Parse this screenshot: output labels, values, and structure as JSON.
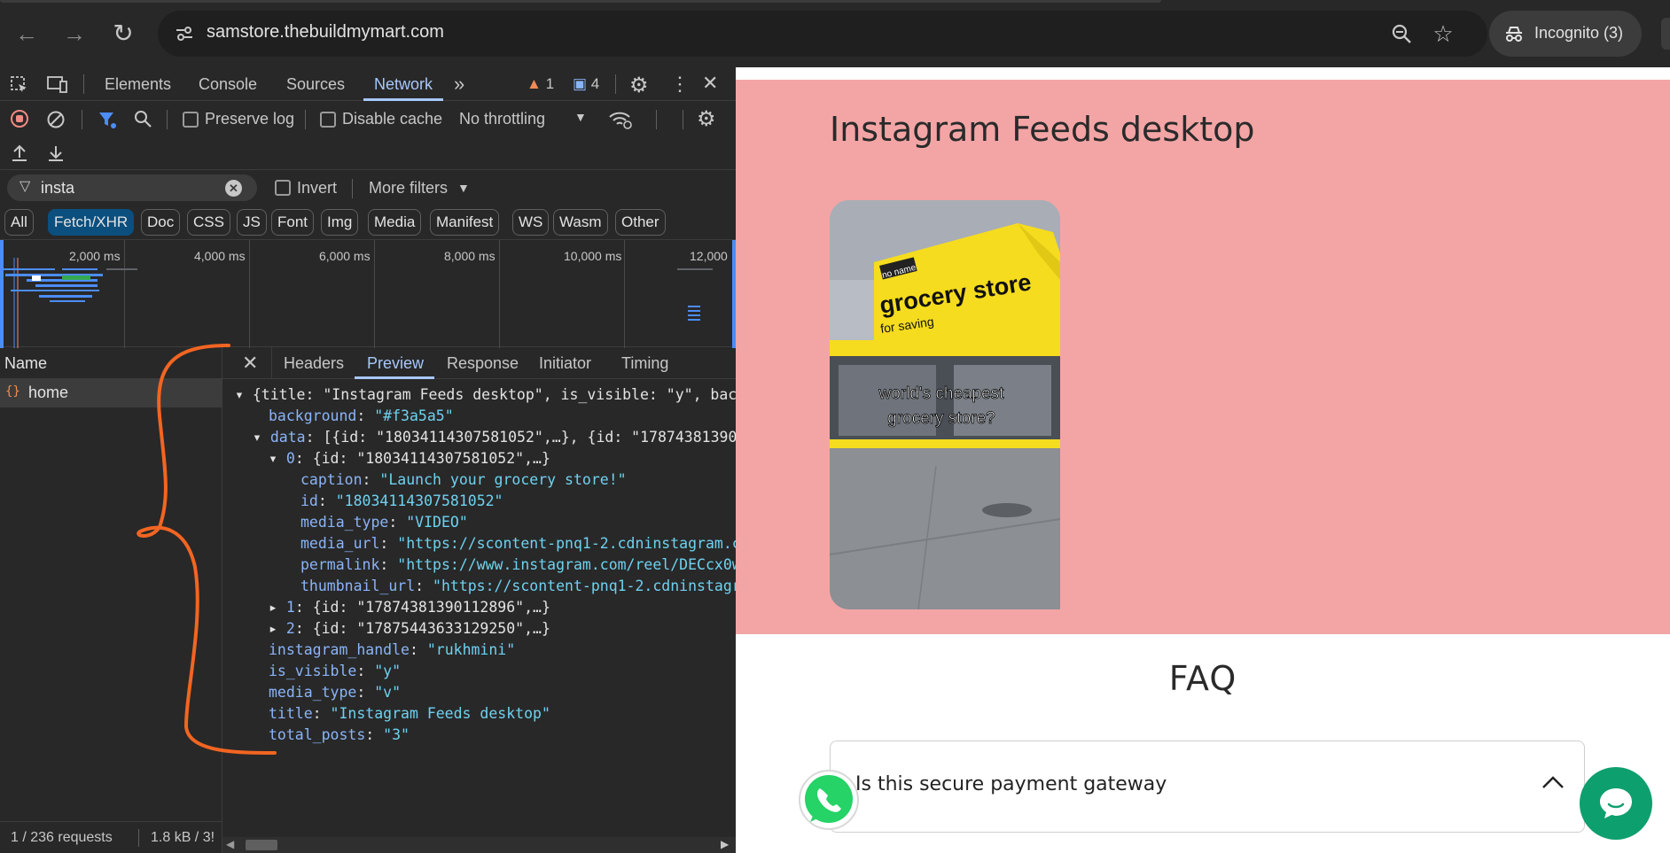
{
  "browser": {
    "url": "samstore.thebuildmymart.com",
    "incognito_label": "Incognito (3)",
    "icons": [
      "back-icon",
      "forward-icon",
      "reload-icon",
      "site-info-icon",
      "zoom-icon",
      "bookmark-star-icon",
      "incognito-icon"
    ]
  },
  "devtools": {
    "tabs": [
      "Elements",
      "Console",
      "Sources",
      "Network"
    ],
    "active_tab": "Network",
    "warnings_count": "1",
    "messages_count": "4",
    "toolbar": {
      "preserve_log": "Preserve log",
      "disable_cache": "Disable cache",
      "throttling": "No throttling"
    },
    "filter": {
      "value": "insta",
      "invert_label": "Invert",
      "more_filters": "More filters"
    },
    "type_filters": [
      "All",
      "Fetch/XHR",
      "Doc",
      "CSS",
      "JS",
      "Font",
      "Img",
      "Media",
      "Manifest",
      "WS",
      "Wasm",
      "Other"
    ],
    "active_type_filter": "Fetch/XHR",
    "timeline_ticks": [
      "2,000 ms",
      "4,000 ms",
      "6,000 ms",
      "8,000 ms",
      "10,000 ms",
      "12,000"
    ],
    "name_column_header": "Name",
    "requests": [
      {
        "name": "home"
      }
    ],
    "detail_tabs": [
      "Headers",
      "Preview",
      "Response",
      "Initiator",
      "Timing"
    ],
    "active_detail_tab": "Preview",
    "status": {
      "requests": "1 / 236 requests",
      "transferred": "1.8 kB / 3!"
    },
    "preview": {
      "root_summary": "{title: \"Instagram Feeds desktop\", is_visible: \"y\", bac",
      "background": "\"#f3a5a5\"",
      "data_summary": "[{id: \"18034114307581052\",…}, {id: \"178743813901",
      "item0_summary": "{id: \"18034114307581052\",…}",
      "item0": {
        "caption": "\"Launch your grocery store!\"",
        "id": "\"18034114307581052\"",
        "media_type": "\"VIDEO\"",
        "media_url": "\"https://scontent-pnq1-2.cdninstagram.c",
        "permalink": "\"https://www.instagram.com/reel/DECcx0w",
        "thumbnail_url": "\"https://scontent-pnq1-2.cdninstagra"
      },
      "item1_summary": "{id: \"17874381390112896\",…}",
      "item2_summary": "{id: \"17875443633129250\",…}",
      "instagram_handle": "\"rukhmini\"",
      "is_visible": "\"y\"",
      "media_type": "\"v\"",
      "title": "\"Instagram Feeds desktop\"",
      "total_posts": "\"3\""
    }
  },
  "page": {
    "insta_title": "Instagram Feeds desktop",
    "thumbnail": {
      "sign_small": "no name",
      "sign_big": "grocery store",
      "sign_sub": "for saving",
      "caption_line1": "world's cheapest",
      "caption_line2": "grocery store?"
    },
    "faq_title": "FAQ",
    "faq_question": "Is this secure payment gateway",
    "colors": {
      "insta_bg": "#f3a5a5",
      "whatsapp": "#25d366",
      "chat": "#0e9f6e",
      "annotation": "#f26522"
    }
  }
}
